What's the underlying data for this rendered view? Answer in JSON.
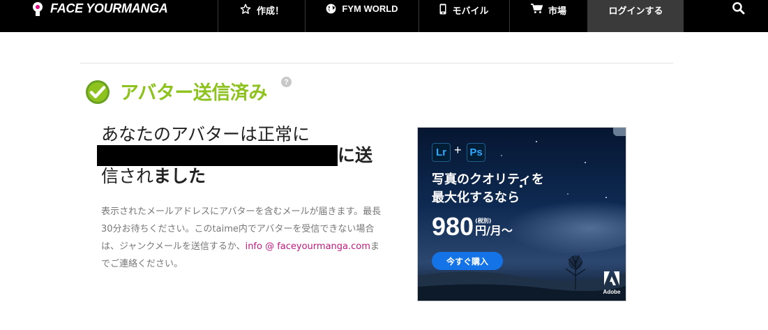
{
  "nav": {
    "logo_text": "FACE YOURMANGA",
    "items": [
      {
        "label": "作成！",
        "icon": "star-icon"
      },
      {
        "label": "FYM WORLD",
        "icon": "globe-icon"
      },
      {
        "label": "モバイル",
        "icon": "mobile-icon"
      },
      {
        "label": "市場",
        "icon": "cart-icon"
      },
      {
        "label": "ログインする",
        "icon": ""
      }
    ],
    "search_icon": "search-icon"
  },
  "main": {
    "title": "アバター送信済み",
    "help_glyph": "?",
    "headline_part1": "あなたのアバターは正常に",
    "headline_part2": "に送",
    "headline_part3_normal": "信され",
    "headline_part3_bold": "ました",
    "notice_text": "表示されたメールアドレスにアバターを含むメールが届きます。最長30分お待ちください。このtaime内でアバターを受信できない場合は、ジャンクメールを送信するか、",
    "notice_link": "info @ faceyourmanga.com",
    "notice_link_after": "までご連絡ください。",
    "colors": {
      "title_green": "#8dc21f",
      "link_magenta": "#c0197e"
    }
  },
  "ad": {
    "badge_lr": "Lr",
    "badge_plus": "+",
    "badge_ps": "Ps",
    "headline_line1": "写真のクオリティを",
    "headline_line2": "最大化するなら",
    "price": "980",
    "tax_note": "(税別)",
    "price_unit": "円/月〜",
    "button_label": "今すぐ購入",
    "brand": "Adobe"
  }
}
